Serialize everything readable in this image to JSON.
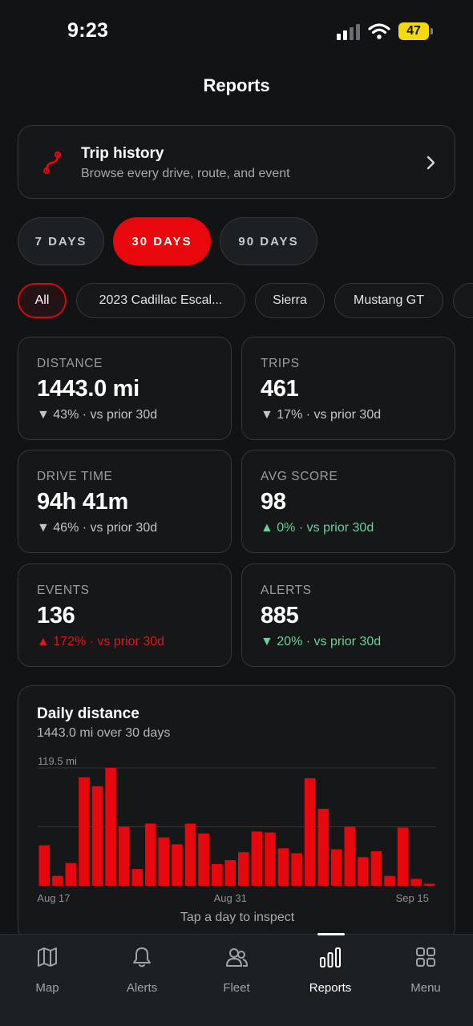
{
  "status": {
    "time": "9:23",
    "battery": "47"
  },
  "page": {
    "title": "Reports"
  },
  "trip_history": {
    "title": "Trip history",
    "subtitle": "Browse every drive, route, and event"
  },
  "ranges": [
    {
      "label": "7 DAYS",
      "active": false
    },
    {
      "label": "30 DAYS",
      "active": true
    },
    {
      "label": "90 DAYS",
      "active": false
    }
  ],
  "vehicles": [
    {
      "label": "All",
      "active": true
    },
    {
      "label": "2023 Cadillac Escal...",
      "active": false
    },
    {
      "label": "Sierra",
      "active": false
    },
    {
      "label": "Mustang GT",
      "active": false
    }
  ],
  "stats": [
    {
      "label": "DISTANCE",
      "value": "1443.0 mi",
      "delta": "▼ 43% · vs prior 30d",
      "trend": "neutral"
    },
    {
      "label": "TRIPS",
      "value": "461",
      "delta": "▼ 17% · vs prior 30d",
      "trend": "neutral"
    },
    {
      "label": "DRIVE TIME",
      "value": "94h 41m",
      "delta": "▼ 46% · vs prior 30d",
      "trend": "neutral"
    },
    {
      "label": "AVG SCORE",
      "value": "98",
      "delta": "▲ 0% · vs prior 30d",
      "trend": "good"
    },
    {
      "label": "EVENTS",
      "value": "136",
      "delta": "▲ 172% · vs prior 30d",
      "trend": "bad"
    },
    {
      "label": "ALERTS",
      "value": "885",
      "delta": "▼ 20% · vs prior 30d",
      "trend": "good"
    }
  ],
  "daily_distance": {
    "title": "Daily distance",
    "subtitle": "1443.0 mi over 30 days",
    "hint": "Tap a day to inspect"
  },
  "chart_data": {
    "type": "bar",
    "ymax_label": "119.5 mi",
    "ylim": [
      0,
      119.5
    ],
    "x_tick_labels": [
      "Aug 17",
      "Aug 31",
      "Sep 15"
    ],
    "values": [
      41,
      10,
      23,
      110,
      101,
      119.5,
      60,
      17,
      63,
      49,
      42,
      63,
      53,
      22,
      26,
      34,
      55,
      54,
      38,
      33,
      109,
      78,
      37,
      60,
      29,
      35,
      10,
      59,
      7,
      2
    ],
    "grid": true,
    "bar_color": "#e7070c"
  },
  "tabs": [
    {
      "label": "Map",
      "icon": "map-icon",
      "active": false
    },
    {
      "label": "Alerts",
      "icon": "bell-icon",
      "active": false
    },
    {
      "label": "Fleet",
      "icon": "people-icon",
      "active": false
    },
    {
      "label": "Reports",
      "icon": "bar-chart-icon",
      "active": true
    },
    {
      "label": "Menu",
      "icon": "grid-icon",
      "active": false
    }
  ],
  "colors": {
    "accent": "#e7070c",
    "background": "#111315",
    "good": "#6fcf97",
    "bad": "#e0161b"
  }
}
